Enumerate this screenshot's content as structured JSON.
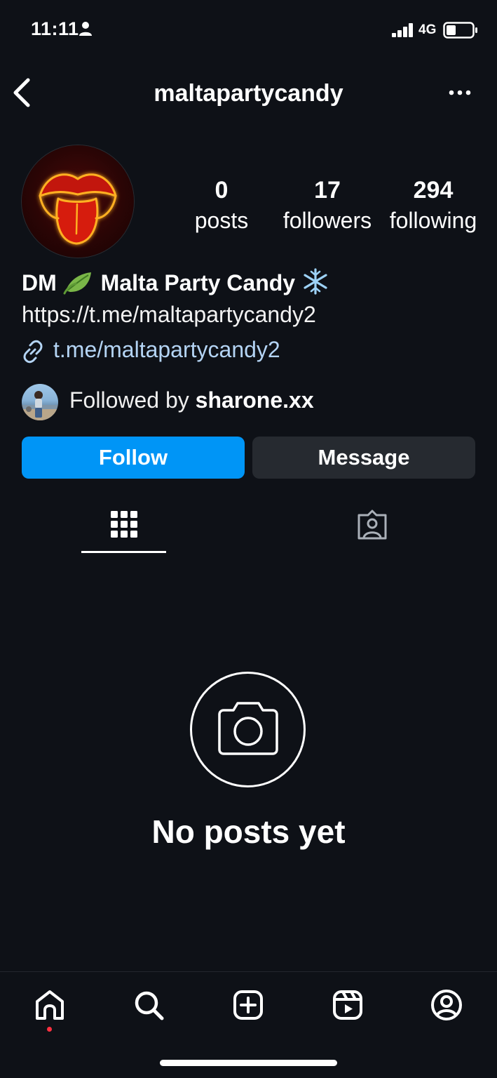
{
  "status_bar": {
    "time": "11:11",
    "network": "4G"
  },
  "header": {
    "username": "maltapartycandy"
  },
  "stats": {
    "posts": {
      "count": "0",
      "label": "posts"
    },
    "followers": {
      "count": "17",
      "label": "followers"
    },
    "following": {
      "count": "294",
      "label": "following"
    }
  },
  "bio": {
    "name_prefix": "DM",
    "name": "Malta Party Candy",
    "text": "https://t.me/maltapartycandy2",
    "link": "t.me/maltapartycandy2"
  },
  "followed_by": {
    "prefix": "Followed by",
    "user": "sharone.xx"
  },
  "actions": {
    "follow_label": "Follow",
    "message_label": "Message"
  },
  "tabs": [
    "grid-icon",
    "tagged-icon"
  ],
  "empty_state": {
    "title": "No posts yet"
  },
  "bottom_nav": [
    "home-icon",
    "search-icon",
    "create-icon",
    "reels-icon",
    "profile-icon"
  ],
  "colors": {
    "background": "#0e1117",
    "follow_button": "#0095f6",
    "message_button": "#262a30",
    "link": "#b4d4f4",
    "notification_dot": "#ff3040"
  }
}
